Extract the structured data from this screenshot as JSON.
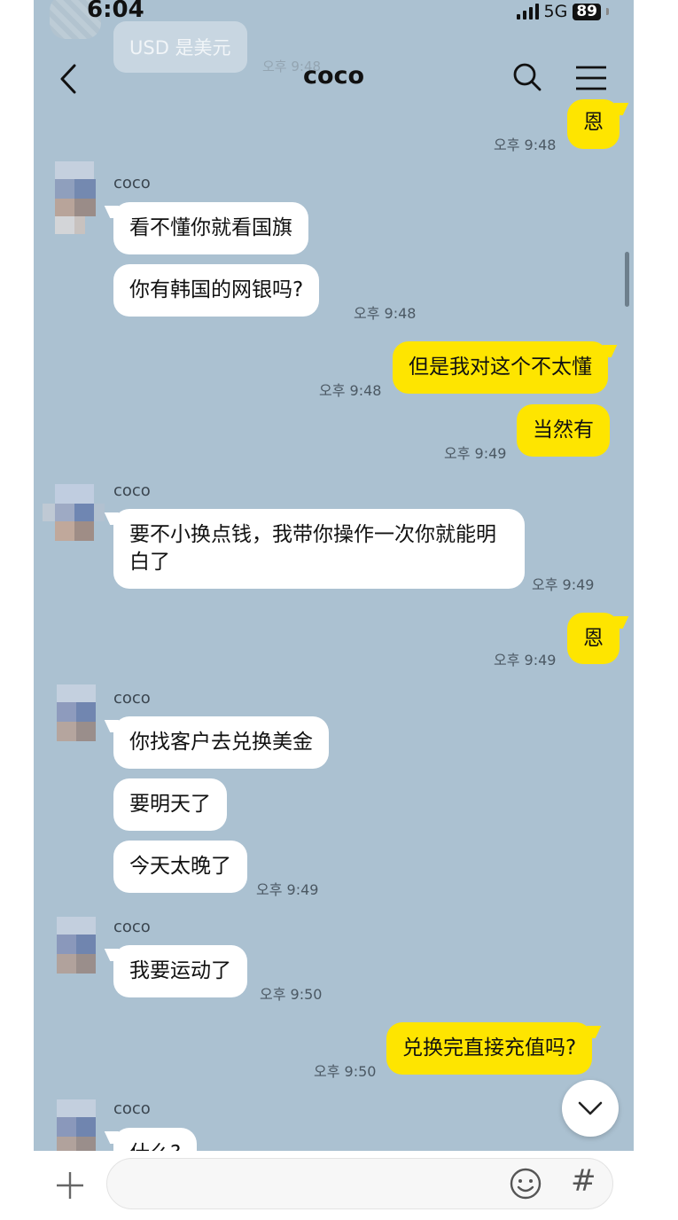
{
  "status_bar": {
    "time": "6:04",
    "network": "5G",
    "battery": "89"
  },
  "ghost_message": {
    "text": "USD 是美元",
    "time": "오후 9:48"
  },
  "header": {
    "title": "coco",
    "back_icon": "chevron-left-icon",
    "search_icon": "search-icon",
    "menu_icon": "hamburger-menu-icon"
  },
  "messages": [
    {
      "from": "me",
      "text": "恩",
      "time": "오후 9:48"
    },
    {
      "from": "coco",
      "sender": "coco",
      "text": "看不懂你就看国旗"
    },
    {
      "from": "coco",
      "text": "你有韩国的网银吗?",
      "time": "오후 9:48"
    },
    {
      "from": "me",
      "text": "但是我对这个不太懂",
      "time": "오후 9:48"
    },
    {
      "from": "me",
      "text": "当然有",
      "time": "오후 9:49"
    },
    {
      "from": "coco",
      "sender": "coco",
      "text": "要不小换点钱，我带你操作一次你就能明白了",
      "time": "오후 9:49"
    },
    {
      "from": "me",
      "text": "恩",
      "time": "오후 9:49"
    },
    {
      "from": "coco",
      "sender": "coco",
      "text": "你找客户去兑换美金"
    },
    {
      "from": "coco",
      "text": "要明天了"
    },
    {
      "from": "coco",
      "text": "今天太晚了",
      "time": "오후 9:49"
    },
    {
      "from": "coco",
      "sender": "coco",
      "text": "我要运动了",
      "time": "오후 9:50"
    },
    {
      "from": "me",
      "text": "兑换完直接充值吗?",
      "time": "오후 9:50"
    },
    {
      "from": "coco",
      "sender": "coco",
      "text": "什么?"
    }
  ],
  "input_bar": {
    "placeholder": "",
    "plus_icon": "plus-icon",
    "emoji_icon": "smiley-icon",
    "hash_icon": "#"
  },
  "colors": {
    "chat_background": "#abc1d1",
    "my_bubble": "#fee500",
    "their_bubble": "#ffffff"
  }
}
